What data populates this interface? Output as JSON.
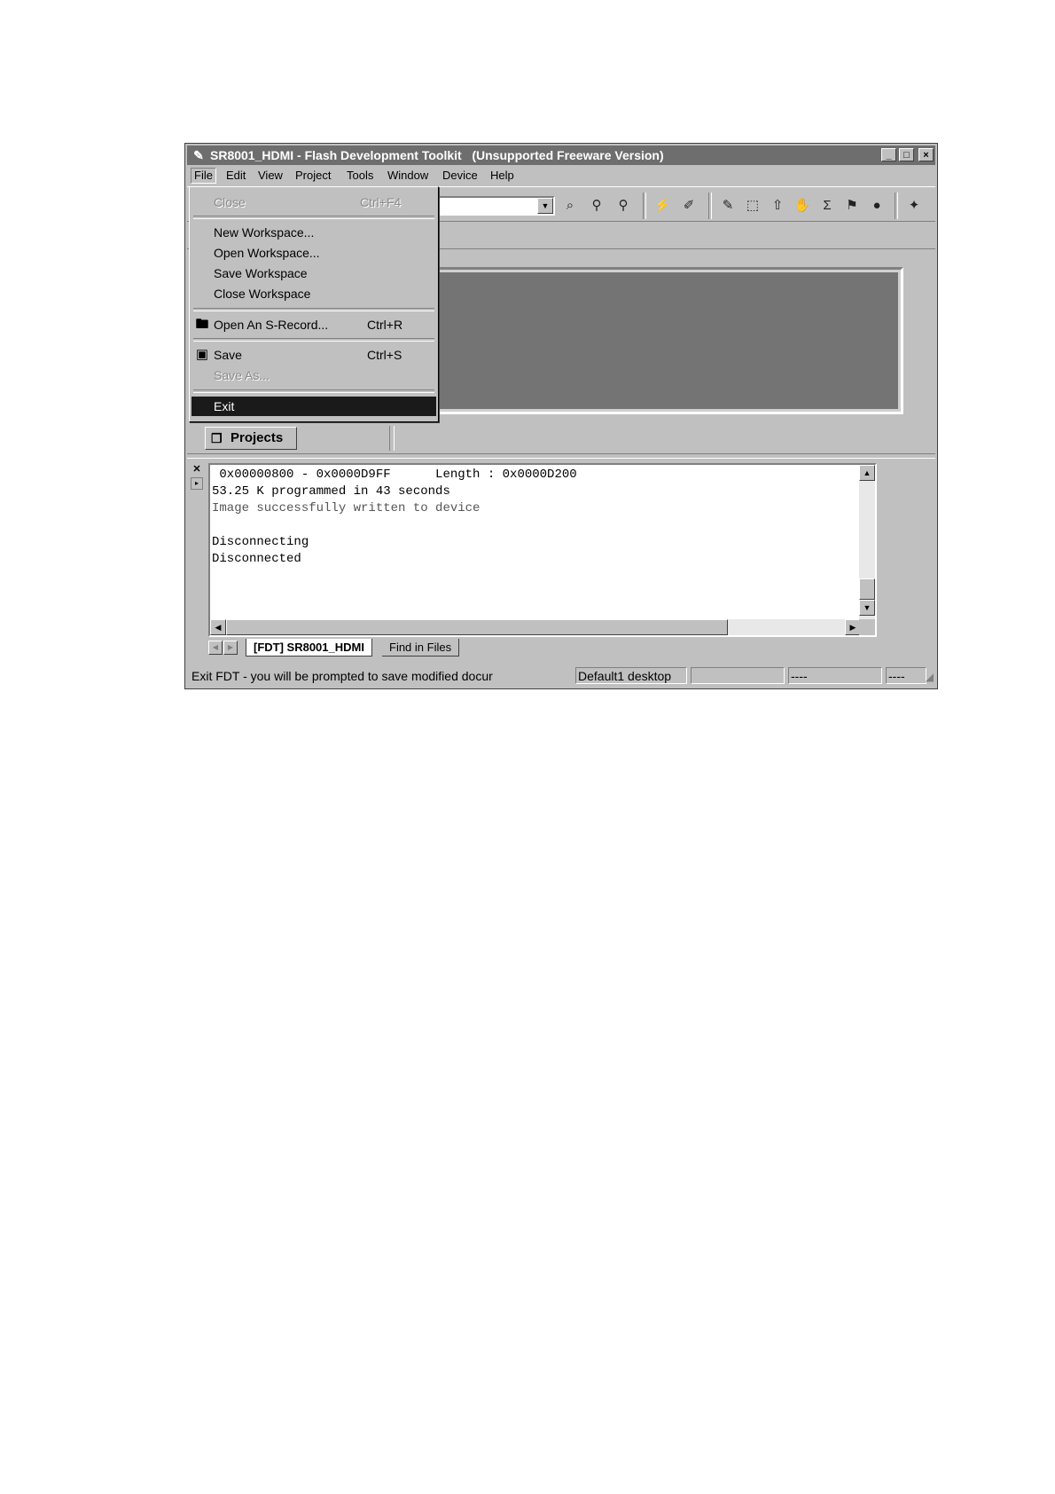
{
  "window": {
    "title": "SR8001_HDMI - Flash Development Toolkit   (Unsupported Freeware Version)",
    "minimize": "_",
    "maximize": "□",
    "close": "×"
  },
  "menubar": {
    "items": [
      {
        "label": "File",
        "open": true
      },
      {
        "label": "Edit"
      },
      {
        "label": "View"
      },
      {
        "label": "Project"
      },
      {
        "label": "Tools"
      },
      {
        "label": "Window"
      },
      {
        "label": "Device"
      },
      {
        "label": "Help"
      }
    ]
  },
  "file_menu": {
    "close": {
      "label": "Close",
      "shortcut": "Ctrl+F4",
      "disabled": true
    },
    "new_workspace": {
      "label": "New Workspace..."
    },
    "open_workspace": {
      "label": "Open Workspace..."
    },
    "save_workspace": {
      "label": "Save Workspace"
    },
    "close_workspace": {
      "label": "Close Workspace"
    },
    "open_srecord": {
      "label": "Open An S-Record...",
      "shortcut": "Ctrl+R",
      "icon": "open-srecord-icon"
    },
    "save": {
      "label": "Save",
      "shortcut": "Ctrl+S",
      "icon": "floppy-disk-icon"
    },
    "save_as": {
      "label": "Save As...",
      "disabled": true
    },
    "exit": {
      "label": "Exit",
      "selected": true
    }
  },
  "toolbar": {
    "combo_value": ""
  },
  "workspace": {
    "projects_tab": "Projects"
  },
  "output": {
    "lines": [
      " 0x00000800 - 0x0000D9FF      Length : 0x0000D200",
      "53.25 K programmed in 43 seconds",
      "Image successfully written to device",
      "",
      "Disconnecting",
      "Disconnected"
    ],
    "tabs": [
      {
        "label": "[FDT] SR8001_HDMI",
        "active": true
      },
      {
        "label": "Find in Files",
        "active": false
      }
    ]
  },
  "statusbar": {
    "message": "Exit FDT - you will be prompted to save modified docur",
    "desktop": "Default1 desktop",
    "pane3": "",
    "pane4": "----",
    "pane5": "----"
  }
}
